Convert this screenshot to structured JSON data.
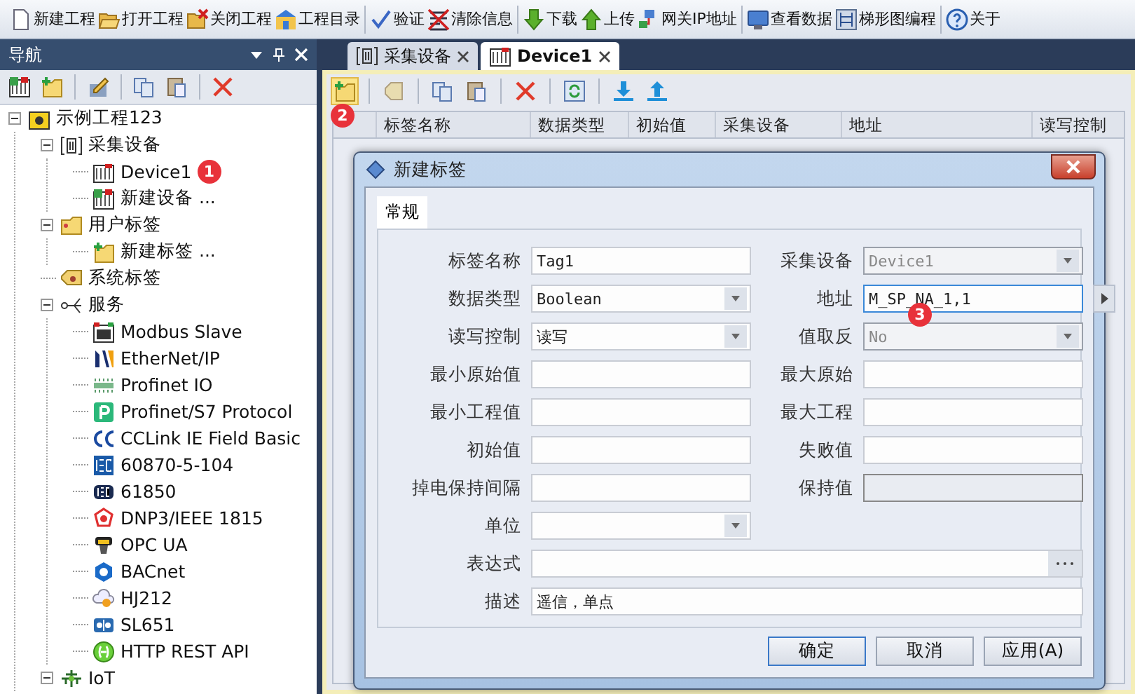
{
  "toolbar": [
    [
      {
        "label": "新建工程",
        "kind": "document"
      },
      {
        "label": "打开工程",
        "kind": "folderopen"
      },
      {
        "label": "关闭工程",
        "kind": "folderclose"
      },
      {
        "label": "工程目录",
        "kind": "folderhome"
      }
    ],
    [
      {
        "label": "验证",
        "kind": "check"
      },
      {
        "label": "清除信息",
        "kind": "clear"
      }
    ],
    [
      {
        "label": "下载",
        "kind": "arrowdown"
      },
      {
        "label": "上传",
        "kind": "arrowup"
      },
      {
        "label": "网关IP地址",
        "kind": "network"
      }
    ],
    [
      {
        "label": "查看数据",
        "kind": "monitor"
      },
      {
        "label": "梯形图编程",
        "kind": "ladder"
      }
    ],
    [
      {
        "label": "关于",
        "kind": "help"
      }
    ]
  ],
  "navigator": {
    "title": "导航",
    "tools": [
      {
        "kind": "deviceadd"
      },
      {
        "kind": "tagadd"
      },
      {
        "kind": "edit"
      },
      {
        "kind": "copy"
      },
      {
        "kind": "paste"
      },
      {
        "kind": "delete"
      }
    ],
    "tree": [
      {
        "label": "示例工程123",
        "kind": "project",
        "expanded": true,
        "children": [
          {
            "label": "采集设备",
            "kind": "devicegroup",
            "expanded": true,
            "children": [
              {
                "label": "Device1",
                "kind": "device",
                "badge": "1"
              },
              {
                "label": "新建设备 ...",
                "kind": "deviceadd"
              }
            ]
          },
          {
            "label": "用户标签",
            "kind": "taggroup",
            "expanded": true,
            "children": [
              {
                "label": "新建标签 ...",
                "kind": "tagadd"
              }
            ]
          },
          {
            "label": "系统标签",
            "kind": "systemtag"
          },
          {
            "label": "服务",
            "kind": "service",
            "expanded": true,
            "children": [
              {
                "label": "Modbus Slave",
                "kind": "modbus"
              },
              {
                "label": "EtherNet/IP",
                "kind": "ethernetip"
              },
              {
                "label": "Profinet IO",
                "kind": "profinet"
              },
              {
                "label": "Profinet/S7 Protocol",
                "kind": "s7"
              },
              {
                "label": "CCLink IE Field Basic",
                "kind": "cclink"
              },
              {
                "label": "60870-5-104",
                "kind": "iec"
              },
              {
                "label": "61850",
                "kind": "iecdark"
              },
              {
                "label": "DNP3/IEEE 1815",
                "kind": "dnp"
              },
              {
                "label": "OPC UA",
                "kind": "opc"
              },
              {
                "label": "BACnet",
                "kind": "bacnet"
              },
              {
                "label": "HJ212",
                "kind": "cloud"
              },
              {
                "label": "SL651",
                "kind": "sl"
              },
              {
                "label": "HTTP REST API",
                "kind": "http"
              }
            ]
          },
          {
            "label": "IoT",
            "kind": "iot",
            "expanded": true
          }
        ]
      }
    ]
  },
  "tabs": [
    {
      "label": "采集设备",
      "kind": "devicegroup",
      "selected": false
    },
    {
      "label": "Device1",
      "kind": "device",
      "selected": true
    }
  ],
  "tag_toolbar": {
    "badge": "2",
    "tools": [
      {
        "kind": "tagadd",
        "highlighted": true
      },
      {
        "kind": "tag",
        "highlighted": false
      },
      {
        "kind": "copy",
        "highlighted": false
      },
      {
        "kind": "paste",
        "highlighted": false
      },
      {
        "kind": "delete",
        "highlighted": false
      },
      {
        "kind": "refresh",
        "highlighted": false
      },
      {
        "kind": "download",
        "highlighted": false
      },
      {
        "kind": "upload",
        "highlighted": false
      }
    ]
  },
  "grid": {
    "columns": [
      "标签名称",
      "数据类型",
      "初始值",
      "采集设备",
      "地址",
      "读写控制"
    ]
  },
  "dialog": {
    "title": "新建标签",
    "tabs": [
      {
        "label": "常规",
        "selected": true
      }
    ],
    "rows": [
      [
        {
          "label": "标签名称",
          "kind": "text",
          "value": "Tag1",
          "disabled": false,
          "focused": false
        },
        {
          "label": "采集设备",
          "kind": "select",
          "value": "Device1",
          "disabled": true,
          "focused": false
        }
      ],
      [
        {
          "label": "数据类型",
          "kind": "select",
          "value": "Boolean",
          "disabled": false,
          "focused": false
        },
        {
          "label": "地址",
          "kind": "address",
          "value": "M_SP_NA_1,1",
          "disabled": false,
          "focused": true,
          "badge": "3"
        }
      ],
      [
        {
          "label": "读写控制",
          "kind": "select",
          "value": "读写",
          "disabled": false,
          "focused": false
        },
        {
          "label": "值取反",
          "kind": "select",
          "value": "No",
          "disabled": true,
          "focused": false
        }
      ],
      [
        {
          "label": "最小原始值",
          "kind": "text",
          "disabled": false,
          "focused": false
        },
        {
          "label": "最大原始",
          "kind": "text",
          "disabled": false,
          "focused": false
        }
      ],
      [
        {
          "label": "最小工程值",
          "kind": "text",
          "disabled": false,
          "focused": false
        },
        {
          "label": "最大工程",
          "kind": "text",
          "disabled": false,
          "focused": false
        }
      ],
      [
        {
          "label": "初始值",
          "kind": "text",
          "disabled": false,
          "focused": false
        },
        {
          "label": "失败值",
          "kind": "text",
          "disabled": false,
          "focused": false
        }
      ],
      [
        {
          "label": "掉电保持间隔",
          "kind": "text",
          "disabled": false,
          "focused": false
        },
        {
          "label": "保持值",
          "kind": "text",
          "disabled": true,
          "focused": false
        }
      ],
      [
        {
          "label": "单位",
          "kind": "select",
          "disabled": false,
          "focused": false
        }
      ],
      [
        {
          "label": "表达式",
          "kind": "expression",
          "disabled": false,
          "focused": false
        }
      ],
      [
        {
          "label": "描述",
          "kind": "wide",
          "value": "遥信，单点",
          "disabled": false,
          "focused": false
        }
      ]
    ],
    "buttons": [
      {
        "label": "确定",
        "default": true
      },
      {
        "label": "取消",
        "default": false
      },
      {
        "label": "应用(A)",
        "default": false
      }
    ]
  }
}
